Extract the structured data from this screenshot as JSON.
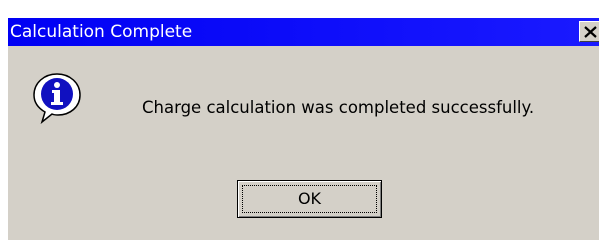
{
  "dialog": {
    "title": "Calculation Complete",
    "message": "Charge calculation was completed successfully.",
    "ok_label": "OK",
    "icon": "info-icon",
    "close_icon": "close-icon"
  },
  "colors": {
    "titlebar": "#0000f4",
    "title_text": "#ffffff",
    "dialog_background": "#d4d0c8",
    "info_icon_fill": "#1010c0"
  }
}
